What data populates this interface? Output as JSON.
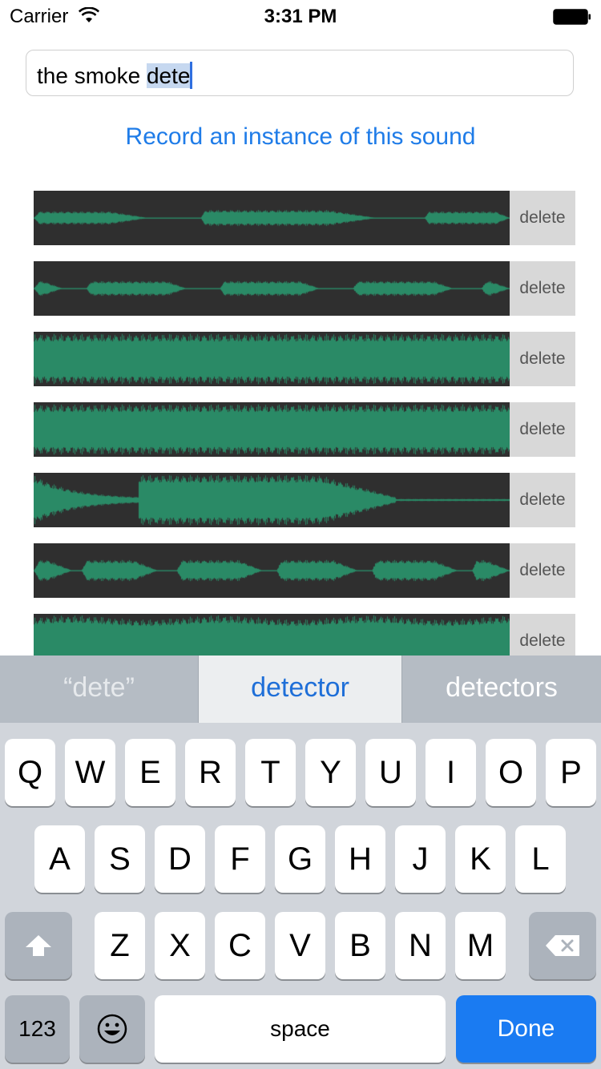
{
  "status_bar": {
    "carrier": "Carrier",
    "time": "3:31 PM"
  },
  "search": {
    "text_plain": "the smoke ",
    "text_selected": "dete"
  },
  "record_link": "Record an instance of this sound",
  "recordings": [
    {
      "delete_label": "delete",
      "pattern": "sparse-3"
    },
    {
      "delete_label": "delete",
      "pattern": "beeps-4"
    },
    {
      "delete_label": "delete",
      "pattern": "full"
    },
    {
      "delete_label": "delete",
      "pattern": "full"
    },
    {
      "delete_label": "delete",
      "pattern": "decay-burst"
    },
    {
      "delete_label": "delete",
      "pattern": "beeps-5"
    },
    {
      "delete_label": "delete",
      "pattern": "loud"
    }
  ],
  "suggestions": [
    "“dete”",
    "detector",
    "detectors"
  ],
  "keyboard": {
    "row1": [
      "Q",
      "W",
      "E",
      "R",
      "T",
      "Y",
      "U",
      "I",
      "O",
      "P"
    ],
    "row2": [
      "A",
      "S",
      "D",
      "F",
      "G",
      "H",
      "J",
      "K",
      "L"
    ],
    "row3": [
      "Z",
      "X",
      "C",
      "V",
      "B",
      "N",
      "M"
    ],
    "numbers_label": "123",
    "space_label": "space",
    "done_label": "Done"
  },
  "colors": {
    "accent": "#1f7ce8",
    "waveform": "#2a8a66",
    "waveform_bg": "#2f2f2f",
    "done_key": "#1a7bf2"
  }
}
